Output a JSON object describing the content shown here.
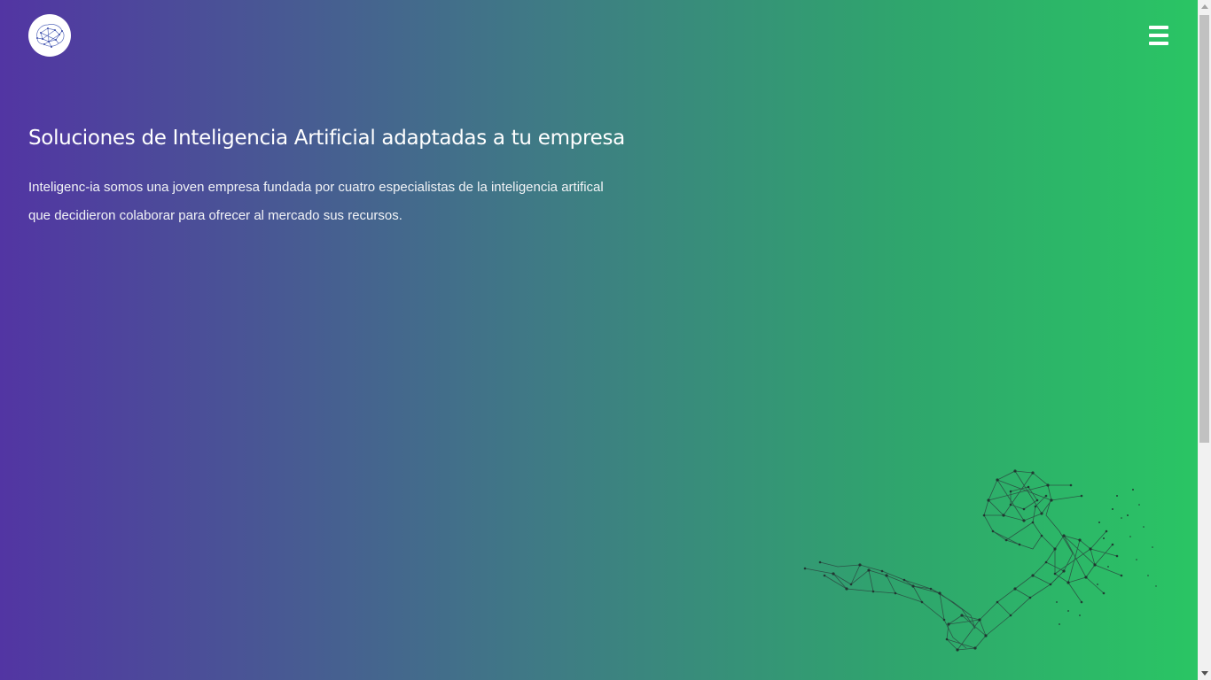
{
  "header": {
    "logo_icon": "brain-network-icon",
    "menu_icon": "hamburger-menu-icon"
  },
  "hero": {
    "title": "Soluciones de Inteligencia Artificial adaptadas a tu empresa",
    "description": "Inteligenc-ia somos una joven empresa fundada por cuatro especialistas de la inteligencia artifical que decidieron colaborar para ofrecer al mercado sus recursos."
  },
  "illustration": {
    "icon": "robot-arm-wireframe-icon"
  },
  "colors": {
    "gradient_start": "#5235a3",
    "gradient_mid": "#3f7a85",
    "gradient_end": "#2ac564",
    "text": "#ffffff"
  }
}
